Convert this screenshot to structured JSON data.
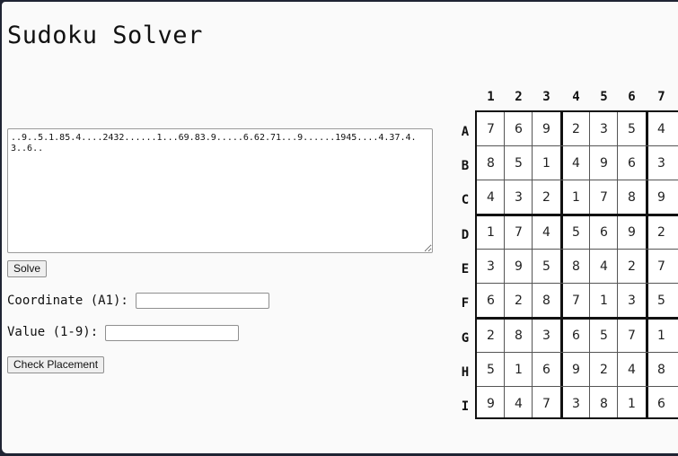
{
  "page": {
    "title": "Sudoku Solver"
  },
  "form": {
    "puzzle_text": "..9..5.1.85.4....2432......1...69.83.9.....6.62.71...9......1945....4.37.4.3..6..",
    "solve_label": "Solve",
    "coordinate_label": "Coordinate (A1):",
    "coordinate_value": "",
    "value_label": "Value (1-9):",
    "value_value": "",
    "check_label": "Check Placement"
  },
  "grid": {
    "column_labels": [
      "1",
      "2",
      "3",
      "4",
      "5",
      "6",
      "7"
    ],
    "row_labels": [
      "A",
      "B",
      "C",
      "D",
      "E",
      "F",
      "G",
      "H",
      "I"
    ],
    "rows": [
      [
        "7",
        "6",
        "9",
        "2",
        "3",
        "5",
        "4"
      ],
      [
        "8",
        "5",
        "1",
        "4",
        "9",
        "6",
        "3"
      ],
      [
        "4",
        "3",
        "2",
        "1",
        "7",
        "8",
        "9"
      ],
      [
        "1",
        "7",
        "4",
        "5",
        "6",
        "9",
        "2"
      ],
      [
        "3",
        "9",
        "5",
        "8",
        "4",
        "2",
        "7"
      ],
      [
        "6",
        "2",
        "8",
        "7",
        "1",
        "3",
        "5"
      ],
      [
        "2",
        "8",
        "3",
        "6",
        "5",
        "7",
        "1"
      ],
      [
        "5",
        "1",
        "6",
        "9",
        "2",
        "4",
        "8"
      ],
      [
        "9",
        "4",
        "7",
        "3",
        "8",
        "1",
        "6"
      ]
    ]
  }
}
